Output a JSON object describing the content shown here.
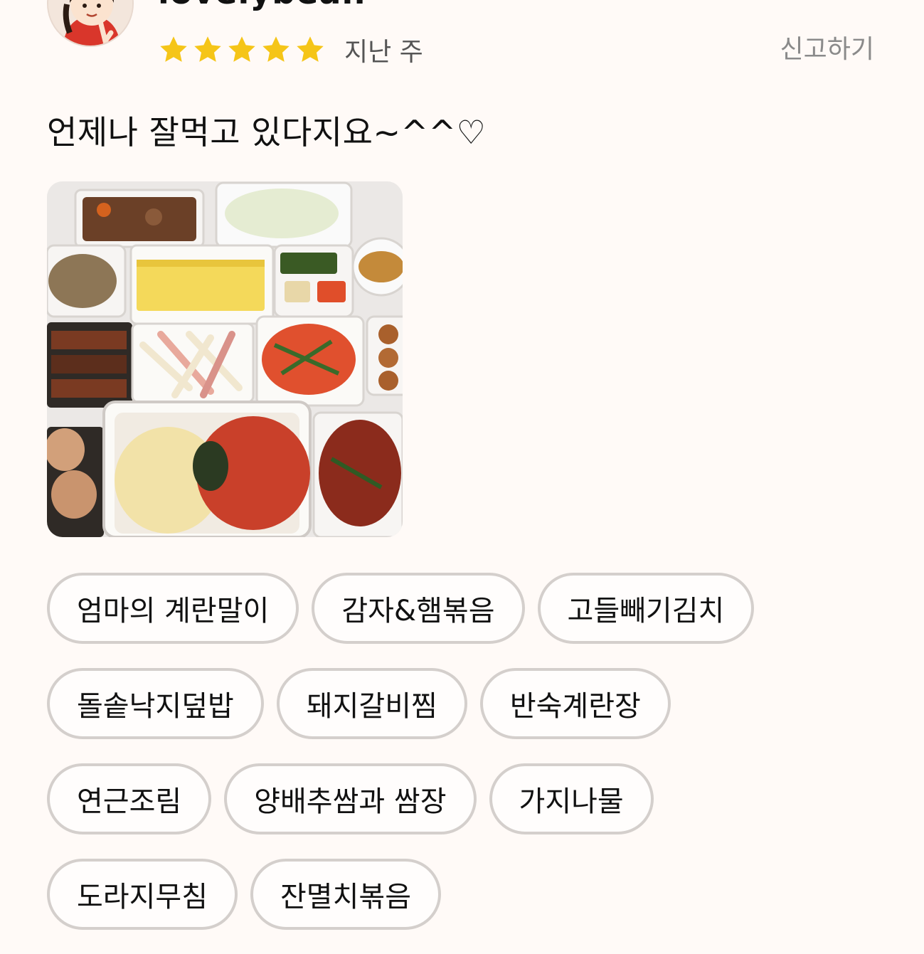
{
  "review": {
    "username": "lovelybean",
    "rating": 5,
    "rating_max": 5,
    "date": "지난 주",
    "report_label": "신고하기",
    "text": "언제나 잘먹고 있다지요~^^♡",
    "photo_description_icon": "food-photo"
  },
  "tags": {
    "row1": [
      "엄마의 계란말이",
      "감자&햄볶음",
      "고들빼기김치"
    ],
    "row2": [
      "돌솥낙지덮밥",
      "돼지갈비찜",
      "반숙계란장"
    ],
    "row3": [
      "연근조림",
      "양배추쌈과 쌈장",
      "가지나물"
    ],
    "row4": [
      "도라지무침",
      "잔멸치볶음"
    ]
  },
  "colors": {
    "star": "#f5c518",
    "tag_border": "#d4cfcc",
    "report": "#8a8a8a",
    "background": "#fffaf7"
  }
}
